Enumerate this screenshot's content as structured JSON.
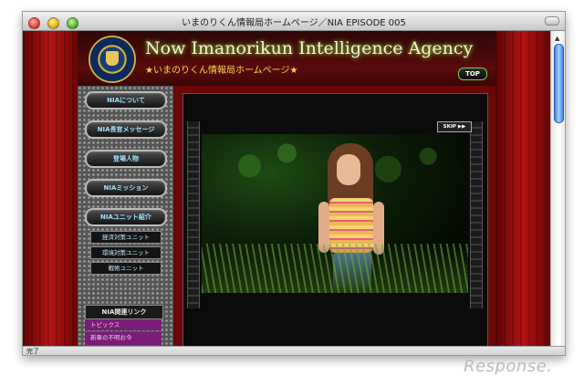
{
  "window": {
    "title": "いまのりくん情報局ホームページ／NIA EPISODE 005",
    "status": "完了"
  },
  "header": {
    "site_title": "Now Imanorikun Intelligence Agency",
    "subtitle": "★いまのりくん情報局ホームページ★",
    "top_button": "TOP"
  },
  "nav": {
    "items": [
      {
        "label": "NIAについて"
      },
      {
        "label": "NIA長官メッセージ"
      },
      {
        "label": "登場人物"
      },
      {
        "label": "NIAミッション"
      },
      {
        "label": "NIAユニット紹介"
      }
    ],
    "subitems": [
      {
        "label": "経済対策ユニット"
      },
      {
        "label": "環境対策ユニット"
      },
      {
        "label": "戦術ユニット"
      }
    ]
  },
  "links": {
    "heading": "NIA関連リンク",
    "items": [
      {
        "label": "トピックス"
      },
      {
        "label": "新車の不明お今"
      }
    ]
  },
  "video": {
    "skip_label": "SKIP ▶▶"
  },
  "watermark": {
    "text": "Response."
  },
  "colors": {
    "page_red": "#7d0a0a",
    "title_glow": "#9bd14a",
    "subtitle_yellow": "#f3d94a",
    "nav_text": "#9fe0ff",
    "links_purple": "#7a1c78",
    "scroll_thumb": "#3d82e8"
  }
}
